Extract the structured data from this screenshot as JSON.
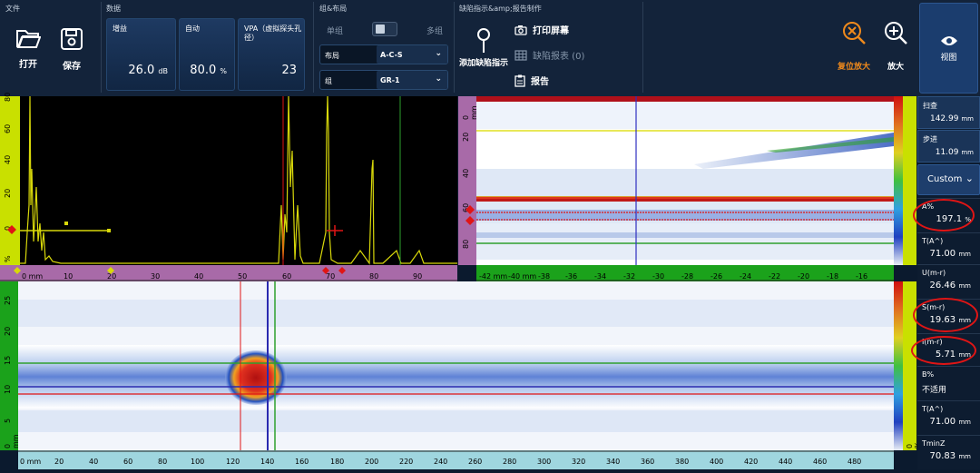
{
  "toolbar": {
    "file_section": "文件",
    "open_label": "打开",
    "save_label": "保存",
    "data_section": "数据",
    "gain": {
      "title": "增益",
      "value": "26.0",
      "unit": "dB"
    },
    "auto": {
      "title": "自动",
      "value": "80.0",
      "unit": "%"
    },
    "vpa": {
      "title": "VPA（虚拟探头孔径）",
      "value": "23"
    },
    "group_section": "组&布局",
    "single_group": "单组",
    "multi_group": "多组",
    "layout_label": "布局",
    "layout_value": "A-C-S",
    "group_label": "组",
    "group_value": "GR-1",
    "indication_section": "缺陷指示&amp;报告制作",
    "add_indication": "添加缺陷指示",
    "print_screen": "打印屏幕",
    "defect_table": "缺陷报表 (0)",
    "report": "报告",
    "reset_zoom": "复位放大",
    "zoom": "放大",
    "view": "视图"
  },
  "colors": {
    "accent_orange": "#f08a1c",
    "trace_yellow": "#d8d80a",
    "cursor_red": "#e01515",
    "cursor_green": "#2ea02e",
    "cursor_blue": "#2a2ab0"
  },
  "ascan": {
    "xaxis_unit": "0 mm",
    "xticks": [
      "10",
      "20",
      "30",
      "40",
      "50",
      "60",
      "70",
      "80",
      "90"
    ],
    "yticks": [
      "80",
      "60",
      "40",
      "20",
      "0"
    ],
    "yunit": "%"
  },
  "sscan": {
    "xticks": [
      "-42 mm",
      "-40 mm",
      "-38",
      "-36",
      "-34",
      "-32",
      "-30",
      "-28",
      "-26",
      "-24",
      "-22",
      "-20",
      "-18",
      "-16"
    ],
    "yticks": [
      "0 mm",
      "20",
      "40",
      "60",
      "80"
    ]
  },
  "cscan": {
    "xticks": [
      "0 mm",
      "20",
      "40",
      "60",
      "80",
      "100",
      "120",
      "140",
      "160",
      "180",
      "200",
      "220",
      "240",
      "260",
      "280",
      "300",
      "320",
      "340",
      "360",
      "380",
      "400",
      "420",
      "440",
      "460",
      "480"
    ],
    "yticks": [
      "25",
      "20",
      "15",
      "10",
      "5",
      "0 mm"
    ],
    "right_unit": "0 %"
  },
  "readings": {
    "scan": {
      "label": "扫查",
      "value": "142.99",
      "unit": "mm"
    },
    "step": {
      "label": "步进",
      "value": "11.09",
      "unit": "mm"
    },
    "custom": "Custom",
    "a_pct": {
      "label": "A%",
      "value": "197.1",
      "unit": "%"
    },
    "t_a1": {
      "label": "T(A^)",
      "value": "71.00",
      "unit": "mm"
    },
    "u_mr": {
      "label": "U(m-r)",
      "value": "26.46",
      "unit": "mm"
    },
    "s_mr": {
      "label": "S(m-r)",
      "value": "19.63",
      "unit": "mm"
    },
    "i_mr": {
      "label": "I(m-r)",
      "value": "5.71",
      "unit": "mm"
    },
    "b_pct": {
      "label": "B%",
      "value": "不适用"
    },
    "t_a2": {
      "label": "T(A^)",
      "value": "71.00",
      "unit": "mm"
    },
    "tminz": {
      "label": "TminZ",
      "value": "70.83",
      "unit": "mm"
    }
  }
}
